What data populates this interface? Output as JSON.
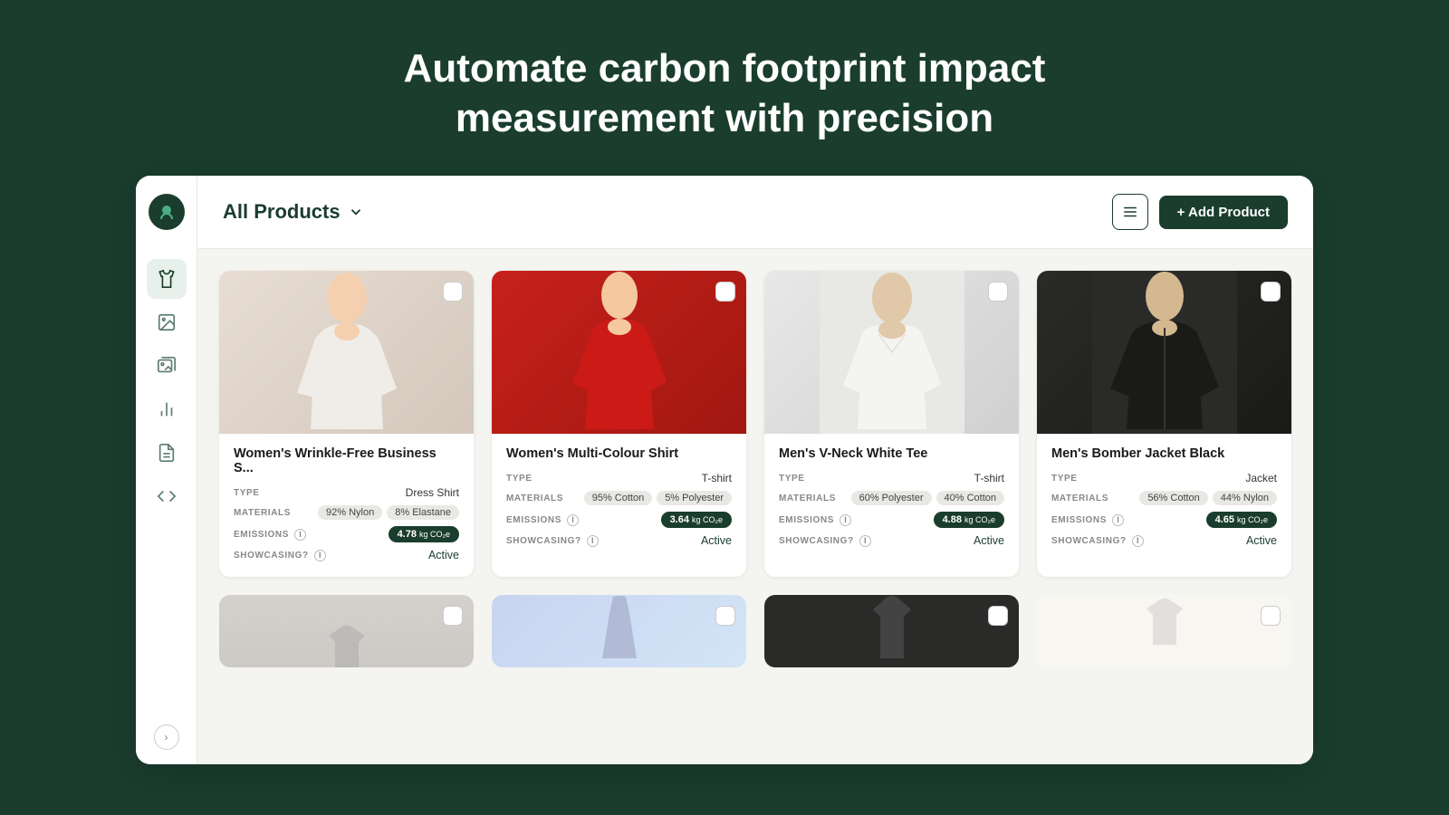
{
  "hero": {
    "line1": "Automate carbon footprint impact",
    "line2": "measurement with precision"
  },
  "header": {
    "all_products_label": "All Products",
    "list_view_label": "List view",
    "add_product_label": "+ Add Product"
  },
  "sidebar": {
    "nav_items": [
      {
        "id": "clothing",
        "icon": "shirt",
        "active": true
      },
      {
        "id": "image1",
        "icon": "image"
      },
      {
        "id": "image2",
        "icon": "image-stack"
      },
      {
        "id": "chart",
        "icon": "bar-chart"
      },
      {
        "id": "doc",
        "icon": "document"
      },
      {
        "id": "code",
        "icon": "code"
      }
    ]
  },
  "products": [
    {
      "id": 1,
      "name": "Women's Wrinkle-Free Business S...",
      "type": "Dress Shirt",
      "materials": [
        "92% Nylon",
        "8% Elastane"
      ],
      "emissions": "4.78",
      "showcasing": "Active"
    },
    {
      "id": 2,
      "name": "Women's Multi-Colour Shirt",
      "type": "T-shirt",
      "materials": [
        "95% Cotton",
        "5% Polyester"
      ],
      "emissions": "3.64",
      "showcasing": "Active"
    },
    {
      "id": 3,
      "name": "Men's V-Neck White Tee",
      "type": "T-shirt",
      "materials": [
        "60% Polyester",
        "40% Cotton"
      ],
      "emissions": "4.88",
      "showcasing": "Active"
    },
    {
      "id": 4,
      "name": "Men's Bomber Jacket Black",
      "type": "Jacket",
      "materials": [
        "56% Cotton",
        "44% Nylon"
      ],
      "emissions": "4.65",
      "showcasing": "Active"
    }
  ],
  "labels": {
    "type": "TYPE",
    "materials": "MATERIALS",
    "emissions": "EMISSIONS",
    "showcasing": "SHOWCASING?",
    "co2_unit": "kg CO₂e"
  }
}
